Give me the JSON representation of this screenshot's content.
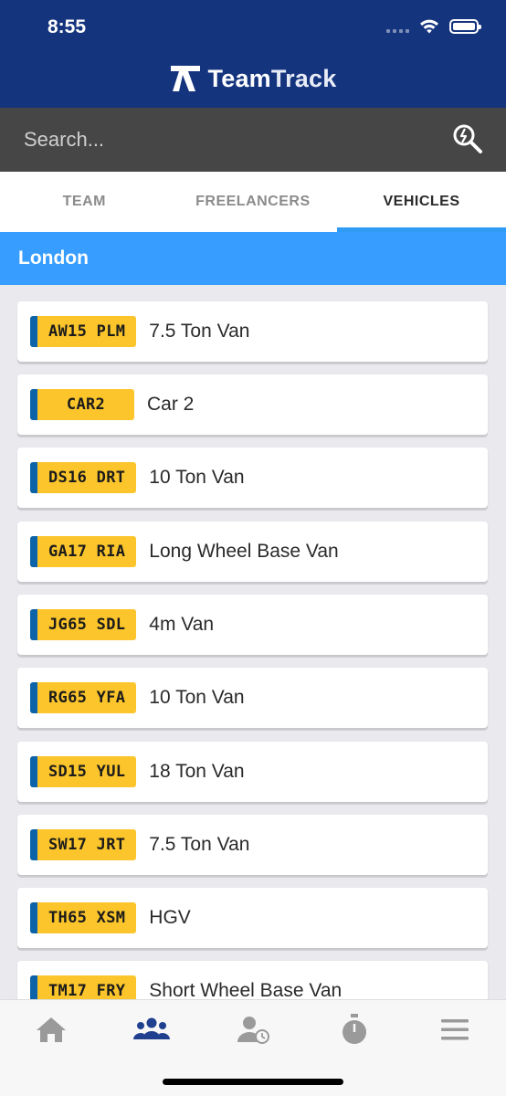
{
  "status_bar": {
    "time": "8:55"
  },
  "app": {
    "brand_main": "Team",
    "brand_second": "Track"
  },
  "search": {
    "placeholder": "Search..."
  },
  "tabs": [
    {
      "label": "TEAM",
      "active": false
    },
    {
      "label": "FREELANCERS",
      "active": false
    },
    {
      "label": "VEHICLES",
      "active": true
    }
  ],
  "section": {
    "title": "London"
  },
  "vehicles": [
    {
      "reg": "AW15 PLM",
      "name": "7.5 Ton Van"
    },
    {
      "reg": "CAR2",
      "name": "Car 2"
    },
    {
      "reg": "DS16 DRT",
      "name": "10 Ton Van"
    },
    {
      "reg": "GA17 RIA",
      "name": "Long Wheel Base Van"
    },
    {
      "reg": "JG65 SDL",
      "name": "4m Van"
    },
    {
      "reg": "RG65 YFA",
      "name": "10 Ton Van"
    },
    {
      "reg": "SD15 YUL",
      "name": "18 Ton Van"
    },
    {
      "reg": "SW17 JRT",
      "name": "7.5 Ton Van"
    },
    {
      "reg": "TH65 XSM",
      "name": "HGV"
    },
    {
      "reg": "TM17 FRY",
      "name": "Short Wheel Base Van"
    }
  ],
  "bottom_nav": [
    {
      "icon": "home-icon",
      "active": false
    },
    {
      "icon": "team-icon",
      "active": true
    },
    {
      "icon": "timesheet-user-icon",
      "active": false
    },
    {
      "icon": "stopwatch-icon",
      "active": false
    },
    {
      "icon": "menu-icon",
      "active": false
    }
  ],
  "colors": {
    "header": "#15347e",
    "search_bar": "#464646",
    "accent": "#379dff",
    "plate_yellow": "#fbc52b",
    "plate_blue": "#0c63a8",
    "nav_active": "#1f3f8f",
    "nav_inactive": "#9a9a9a"
  }
}
